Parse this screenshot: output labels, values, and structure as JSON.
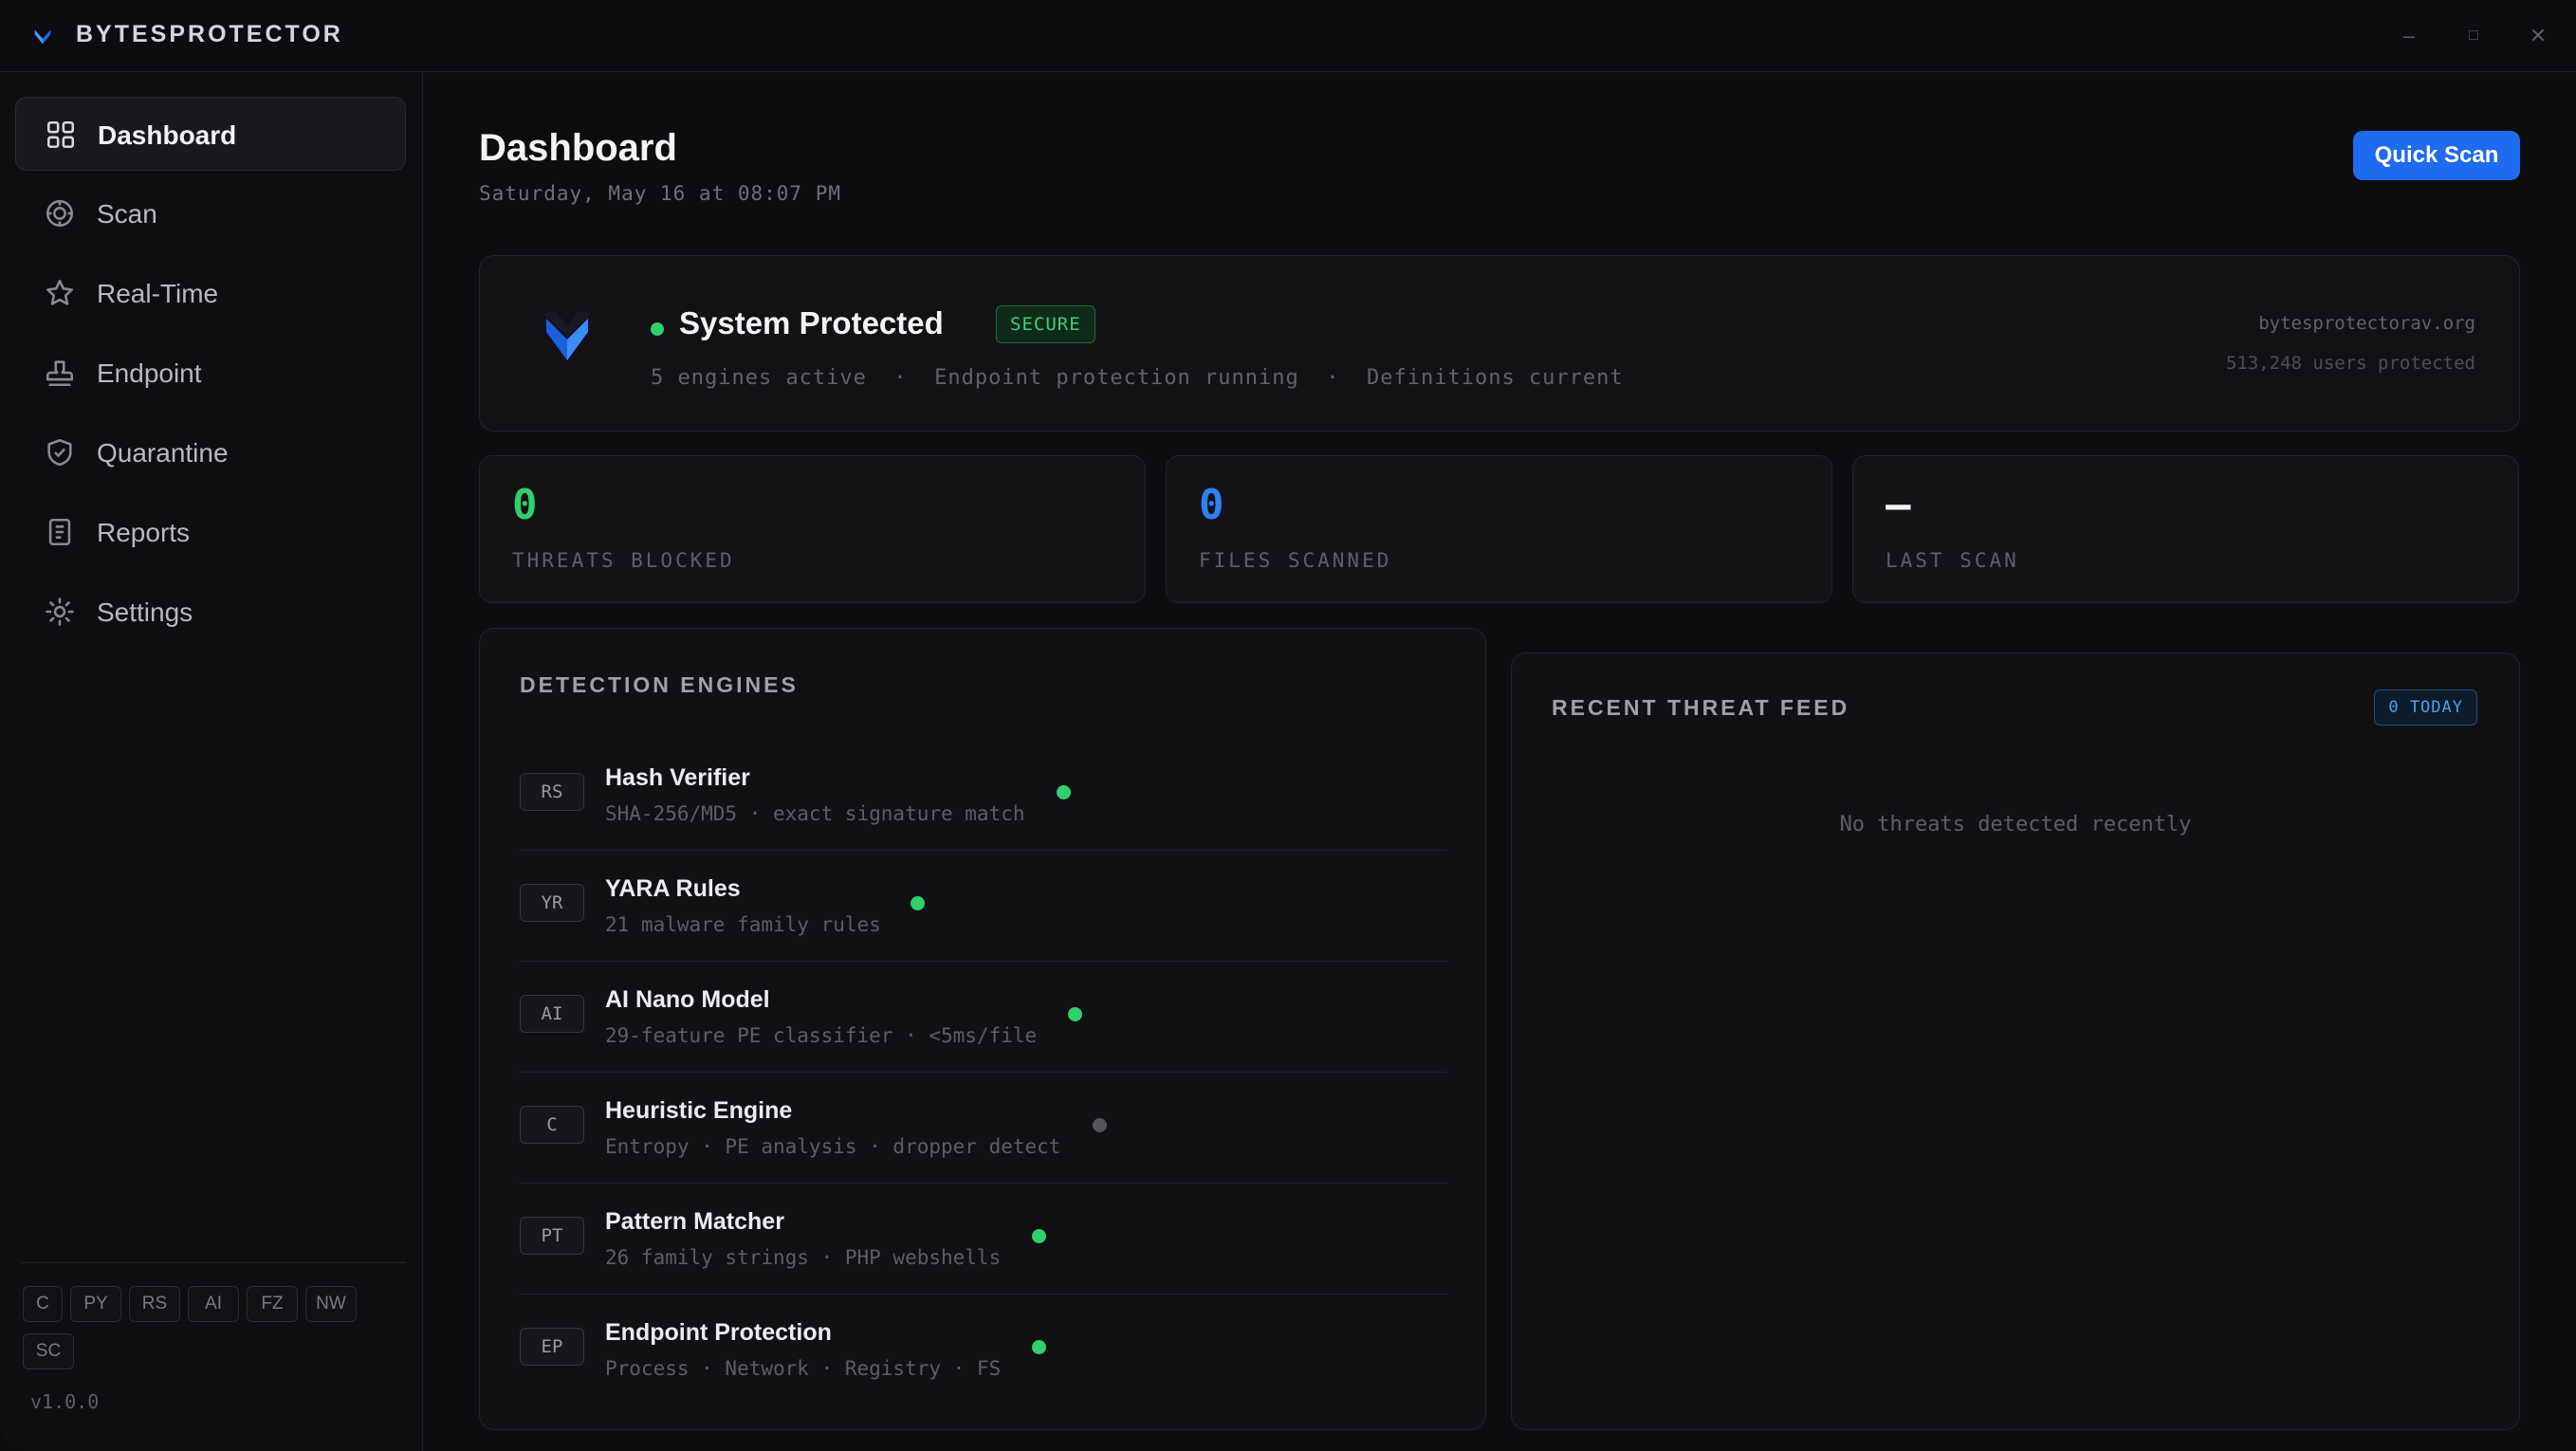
{
  "app": {
    "title": "BYTESPROTECTOR",
    "version": "v1.0.0"
  },
  "window_controls": {
    "minimize": "–",
    "maximize": "□",
    "close": "✕"
  },
  "sidebar": {
    "items": [
      {
        "label": "Dashboard",
        "icon": "grid-icon",
        "active": true
      },
      {
        "label": "Scan",
        "icon": "target-icon"
      },
      {
        "label": "Real-Time",
        "icon": "star-icon"
      },
      {
        "label": "Endpoint",
        "icon": "stamp-icon"
      },
      {
        "label": "Quarantine",
        "icon": "shield-check-icon"
      },
      {
        "label": "Reports",
        "icon": "document-icon"
      },
      {
        "label": "Settings",
        "icon": "sun-gear-icon"
      }
    ],
    "chips": [
      "C",
      "PY",
      "RS",
      "AI",
      "FZ",
      "NW",
      "SC"
    ]
  },
  "header": {
    "title": "Dashboard",
    "date": "Saturday, May 16 at 08:07 PM",
    "quick_scan_label": "Quick Scan"
  },
  "status": {
    "title": "System Protected",
    "badge": "SECURE",
    "subtitle": "5 engines active  ·  Endpoint protection running  ·  Definitions current",
    "url": "bytesprotectorav.org",
    "users": "513,248 users protected",
    "color": "#2fd16a"
  },
  "stats": [
    {
      "value": "0",
      "label": "THREATS BLOCKED",
      "color": "#2fd16a"
    },
    {
      "value": "0",
      "label": "FILES SCANNED",
      "color": "#2f7ff5"
    },
    {
      "value": "—",
      "label": "LAST SCAN",
      "color": "#f4f4f7"
    }
  ],
  "engines": {
    "heading": "DETECTION ENGINES",
    "items": [
      {
        "code": "RS",
        "name": "Hash Verifier",
        "desc": "SHA-256/MD5 · exact signature match",
        "status": "active"
      },
      {
        "code": "YR",
        "name": "YARA Rules",
        "desc": "21 malware family rules",
        "status": "active"
      },
      {
        "code": "AI",
        "name": "AI Nano Model",
        "desc": "29-feature PE classifier · <5ms/file",
        "status": "active"
      },
      {
        "code": "C",
        "name": "Heuristic Engine",
        "desc": "Entropy · PE analysis · dropper detect",
        "status": "inactive"
      },
      {
        "code": "PT",
        "name": "Pattern Matcher",
        "desc": "26 family strings · PHP webshells",
        "status": "active"
      },
      {
        "code": "EP",
        "name": "Endpoint Protection",
        "desc": "Process · Network · Registry · FS",
        "status": "active"
      }
    ]
  },
  "feed": {
    "heading": "RECENT THREAT FEED",
    "badge": "0 TODAY",
    "empty_text": "No threats detected recently"
  },
  "colors": {
    "accent": "#1f6bf0",
    "active": "#2fd16a",
    "inactive": "#55555e"
  }
}
